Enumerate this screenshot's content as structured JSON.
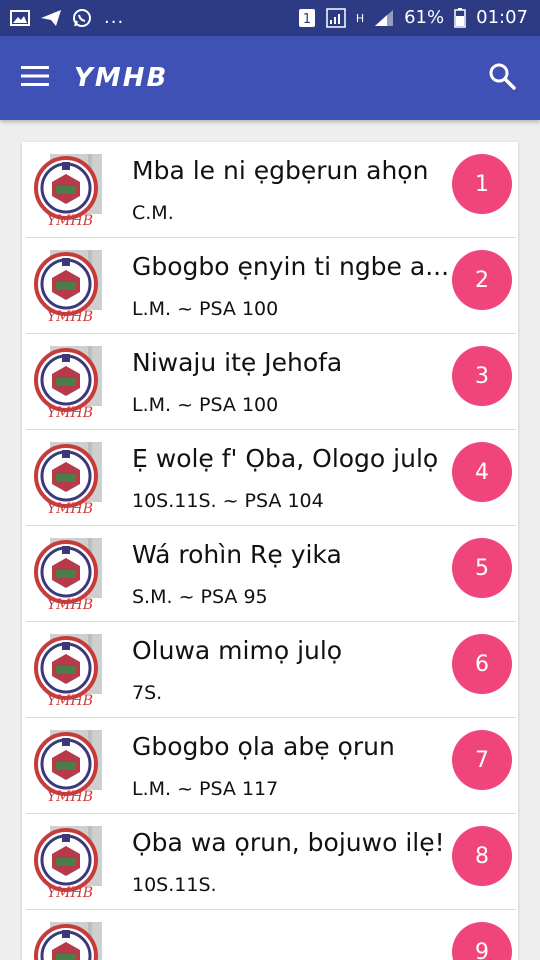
{
  "status_bar": {
    "battery_percent": "61%",
    "time": "01:07",
    "network_label": "H",
    "more_indicator": "..."
  },
  "app_bar": {
    "title": "YMHB",
    "menu_icon": "menu-icon",
    "search_icon": "search-icon"
  },
  "colors": {
    "app_bar": "#3f51b5",
    "status_bar": "#2d3b84",
    "badge": "#f0457a",
    "background": "#eeeeee"
  },
  "hymns": [
    {
      "number": "1",
      "title": "Mba le ni ẹgbẹrun ahọn",
      "meter": "C.M."
    },
    {
      "number": "2",
      "title": "Gbogbo ẹnyin ti ngbe a...",
      "meter": "L.M. ~ PSA 100"
    },
    {
      "number": "3",
      "title": "Niwaju itẹ Jehofa",
      "meter": "L.M. ~ PSA 100"
    },
    {
      "number": "4",
      "title": "Ẹ wolẹ f' Ọba, Ologo julọ",
      "meter": "10S.11S. ~ PSA 104"
    },
    {
      "number": "5",
      "title": "Wá rohìn Rẹ yika",
      "meter": "S.M. ~ PSA 95"
    },
    {
      "number": "6",
      "title": "Oluwa mimọ julọ",
      "meter": "7S."
    },
    {
      "number": "7",
      "title": "Gbogbo ọla abẹ ọrun",
      "meter": "L.M. ~ PSA 117"
    },
    {
      "number": "8",
      "title": "Ọba wa ọrun, bojuwo ilẹ!",
      "meter": "10S.11S."
    },
    {
      "number": "9",
      "title": "",
      "meter": ""
    }
  ]
}
